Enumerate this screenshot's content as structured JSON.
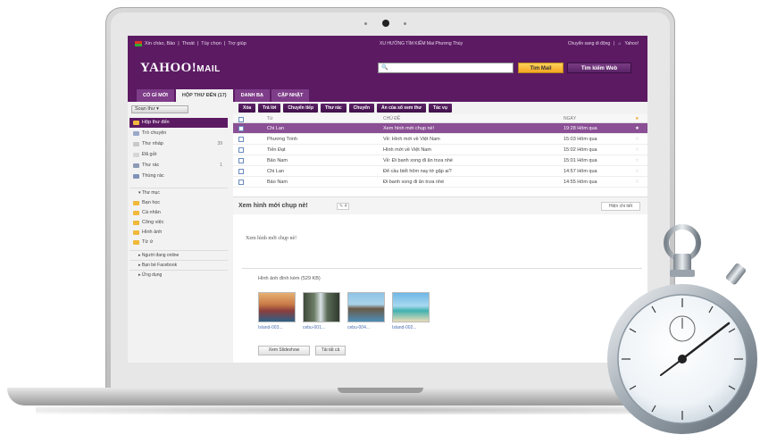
{
  "topbar": {
    "greeting": "Xin chào, Bảo",
    "links": [
      "Thoát",
      "Tùy chọn",
      "Trợ giúp"
    ],
    "trending": "XU HƯỚNG TÌM KIẾM  Mai Phương Thúy",
    "switch_link": "Chuyển sang di động",
    "yahoo_link": "Yahoo!"
  },
  "header": {
    "logo": "YAHOO!",
    "logo_suffix": "MAIL",
    "search_placeholder": "",
    "search_mail_label": "Tìm Mail",
    "search_web_label": "Tìm kiếm Web"
  },
  "tabs": [
    {
      "label": "CÓ GÌ MỚI"
    },
    {
      "label": "HỘP THƯ ĐẾN (17)"
    },
    {
      "label": "DANH BẠ"
    },
    {
      "label": "CẬP NHẬT"
    }
  ],
  "sidebar": {
    "compose_label": "Soạn thư",
    "items": [
      {
        "label": "Hộp thư đến",
        "count": ""
      },
      {
        "label": "Trò chuyện",
        "count": ""
      },
      {
        "label": "Thư nháp",
        "count": "39"
      },
      {
        "label": "Đã gửi",
        "count": ""
      },
      {
        "label": "Thư rác",
        "count": "1"
      },
      {
        "label": "Thùng rác",
        "count": ""
      }
    ],
    "folders_header": "Thư mục",
    "folders": [
      "Bạn học",
      "Cá nhân",
      "Công việc",
      "Hình ảnh",
      "Từ ứ"
    ],
    "sections": [
      "Người đang online",
      "Bạn bè Facebook",
      "Ứng dụng"
    ]
  },
  "toolbar": {
    "buttons": [
      "Xóa",
      "Trả lời",
      "Chuyển tiếp",
      "Thư rác",
      "Chuyển",
      "Ẩn của sổ xem thư",
      "Tác vụ"
    ]
  },
  "list": {
    "headers": {
      "from": "Từ",
      "subject": "CHỦ ĐỀ",
      "date": "NGÀY"
    },
    "rows": [
      {
        "from": "Chi Lan",
        "subject": "Xem hình mới chụp nè!",
        "date": "19:28 Hôm qua",
        "selected": true
      },
      {
        "from": "Phương Trinh",
        "subject": "Về: Hình mới về Việt Nam",
        "date": "15:03 Hôm qua",
        "selected": false
      },
      {
        "from": "Tiến Đạt",
        "subject": "Hình mới về Việt Nam",
        "date": "15:02 Hôm qua",
        "selected": false
      },
      {
        "from": "Bảo Nam",
        "subject": "Về: Đi banh xong đi ăn trưa nhé",
        "date": "15:01 Hôm qua",
        "selected": false
      },
      {
        "from": "Chi Lan",
        "subject": "Để cầu biết hôm nay tớ gặp ai?",
        "date": "14:57 Hôm qua",
        "selected": false
      },
      {
        "from": "Bảo Nam",
        "subject": "Đi banh xong đi ăn trưa nhé",
        "date": "14:55 Hôm qua",
        "selected": false
      }
    ]
  },
  "preview": {
    "title": "Xem hình mới chụp nè!",
    "count": "4",
    "details_label": "Hiện chi tiết",
    "body": "Xem hình mới chụp nè!",
    "attach_title": "Hình ảnh đính kèm (529 KB)",
    "thumbs": [
      {
        "label": "Island-003..."
      },
      {
        "label": "cebu-001..."
      },
      {
        "label": "cebu-004..."
      },
      {
        "label": "Island-002..."
      }
    ],
    "slideshow_label": "Xem Slideshow",
    "all_label": "Tải tất cả"
  },
  "colors": {
    "brand": "#5c1a63",
    "selected_row": "#8a4f94",
    "search_mail": "#f5a623"
  }
}
